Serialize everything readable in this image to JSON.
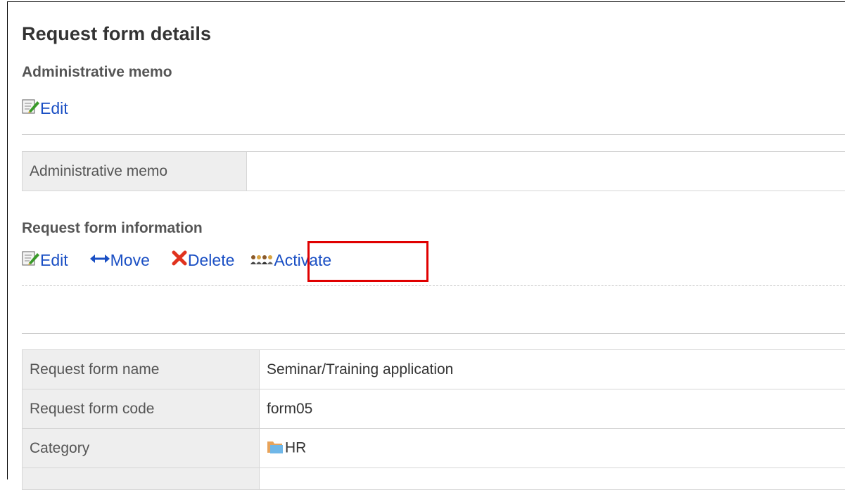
{
  "page": {
    "title": "Request form details"
  },
  "admin_memo": {
    "heading": "Administrative memo",
    "edit_label": "Edit",
    "row_label": "Administrative memo",
    "row_value": ""
  },
  "form_info": {
    "heading": "Request form information",
    "actions": {
      "edit": "Edit",
      "move": "Move",
      "delete": "Delete",
      "activate": "Activate"
    },
    "rows": [
      {
        "label": "Request form name",
        "value": "Seminar/Training application"
      },
      {
        "label": "Request form code",
        "value": "form05"
      },
      {
        "label": "Category",
        "value": "HR"
      }
    ]
  },
  "icons": {
    "edit": "edit-memo-icon",
    "move": "left-right-arrow-icon",
    "delete": "red-x-icon",
    "activate": "people-icon",
    "category": "folder-icon"
  },
  "colors": {
    "link": "#1a4fc4",
    "highlight": "#e00000",
    "label_bg": "#eeeeee"
  }
}
